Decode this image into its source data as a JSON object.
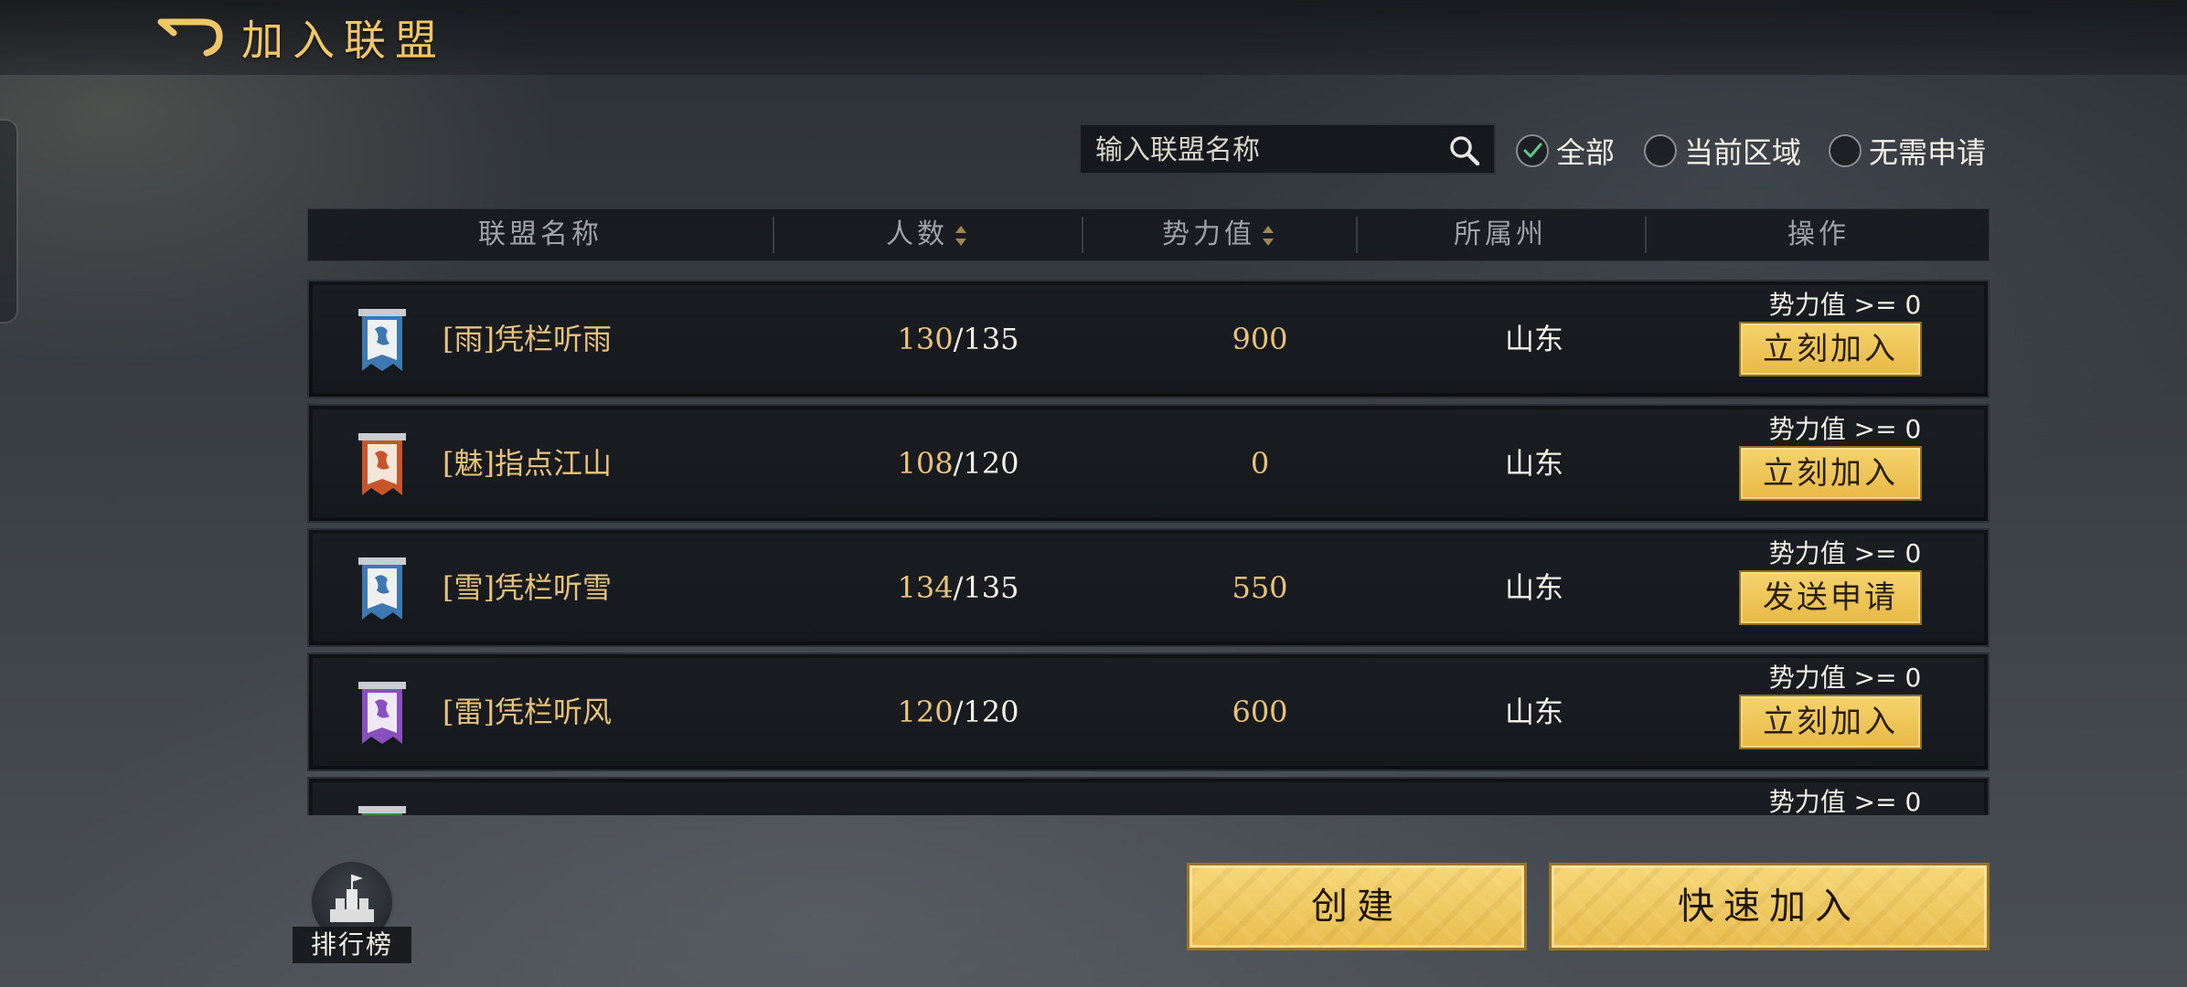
{
  "header": {
    "title": "加入联盟"
  },
  "search": {
    "placeholder": "输入联盟名称"
  },
  "filters": [
    {
      "label": "全部",
      "checked": true
    },
    {
      "label": "当前区域",
      "checked": false
    },
    {
      "label": "无需申请",
      "checked": false
    }
  ],
  "columns": {
    "name": "联盟名称",
    "members": "人数",
    "power": "势力值",
    "region": "所属州",
    "action": "操作"
  },
  "rows": [
    {
      "name": "[雨]凭栏听雨",
      "members_current": "130",
      "members_max": "/135",
      "power": "900",
      "region": "山东",
      "requirement": "势力值 >= 0",
      "action": "立刻加入",
      "banner_color": "#3d78b0"
    },
    {
      "name": "[魅]指点江山",
      "members_current": "108",
      "members_max": "/120",
      "power": "0",
      "region": "山东",
      "requirement": "势力值 >= 0",
      "action": "立刻加入",
      "banner_color": "#c7552b"
    },
    {
      "name": "[雪]凭栏听雪",
      "members_current": "134",
      "members_max": "/135",
      "power": "550",
      "region": "山东",
      "requirement": "势力值 >= 0",
      "action": "发送申请",
      "banner_color": "#3d78b0"
    },
    {
      "name": "[雷]凭栏听风",
      "members_current": "120",
      "members_max": "/120",
      "power": "600",
      "region": "山东",
      "requirement": "势力值 >= 0",
      "action": "立刻加入",
      "banner_color": "#8a4fbf"
    },
    {
      "name": "",
      "members_current": "",
      "members_max": "",
      "power": "",
      "region": "",
      "requirement": "势力值 >= 0",
      "action": "",
      "banner_color": "#3f8a4e"
    }
  ],
  "bottom": {
    "create": "创建",
    "quick_join": "快速加入",
    "ranking": "排行榜"
  },
  "colors": {
    "accent_gold": "#f0c766",
    "button_gold": "#e8b946",
    "check_green": "#5cc98a"
  }
}
